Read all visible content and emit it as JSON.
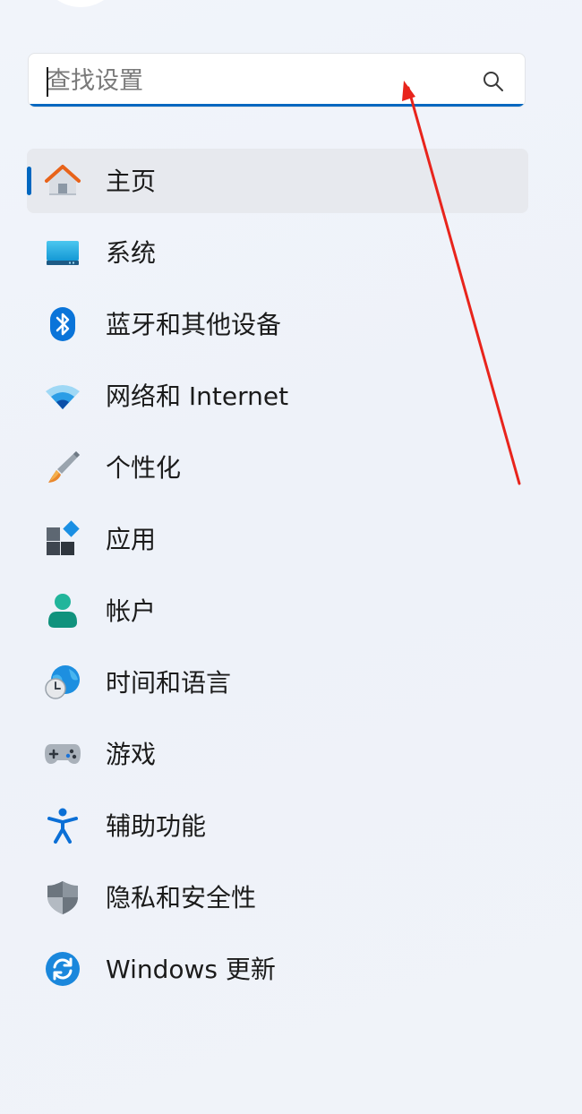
{
  "search": {
    "placeholder": "查找设置",
    "value": ""
  },
  "nav": {
    "items": [
      {
        "label": "主页",
        "icon": "home-icon",
        "selected": true
      },
      {
        "label": "系统",
        "icon": "system-icon"
      },
      {
        "label": "蓝牙和其他设备",
        "icon": "bluetooth-icon"
      },
      {
        "label": "网络和 Internet",
        "icon": "wifi-icon"
      },
      {
        "label": "个性化",
        "icon": "paintbrush-icon"
      },
      {
        "label": "应用",
        "icon": "apps-icon"
      },
      {
        "label": "帐户",
        "icon": "account-icon"
      },
      {
        "label": "时间和语言",
        "icon": "time-language-icon"
      },
      {
        "label": "游戏",
        "icon": "gamepad-icon"
      },
      {
        "label": "辅助功能",
        "icon": "accessibility-icon"
      },
      {
        "label": "隐私和安全性",
        "icon": "shield-icon"
      },
      {
        "label": "Windows 更新",
        "icon": "windows-update-icon"
      }
    ]
  },
  "colors": {
    "accent": "#0067c0",
    "annotation_arrow": "#e8241c",
    "selected_background": "#e7e9ee"
  }
}
